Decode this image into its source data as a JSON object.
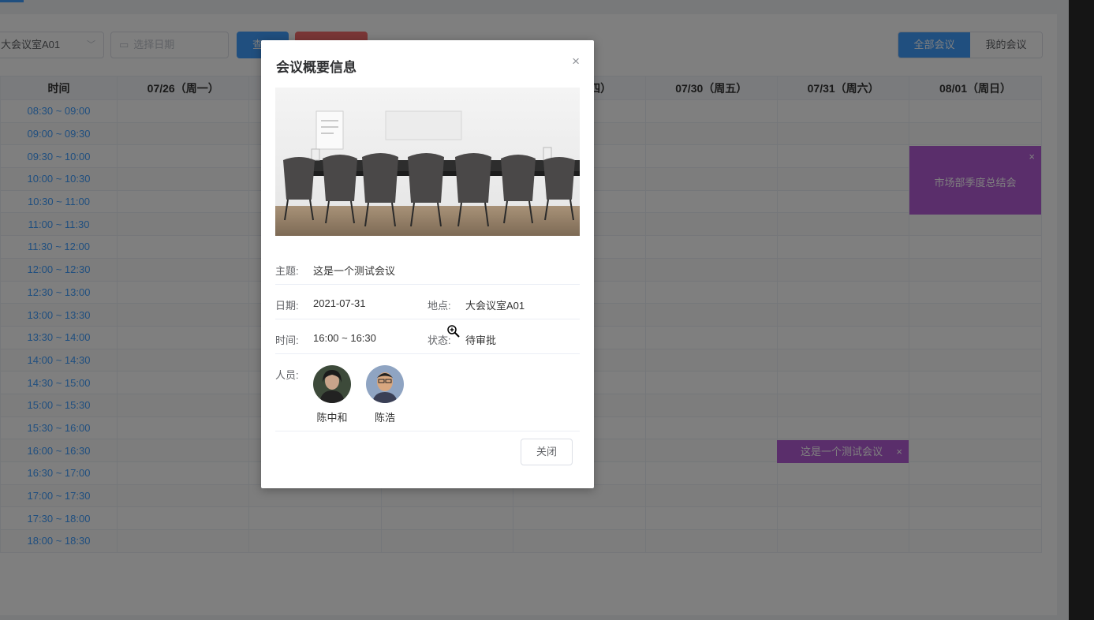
{
  "toolbar": {
    "room_value": "大会议室A01",
    "date_placeholder": "选择日期",
    "query_label": "查",
    "view_all": "全部会议",
    "view_mine": "我的会议"
  },
  "schedule": {
    "headers": [
      "时间",
      "07/26（周一）",
      "",
      "",
      "四）",
      "07/30（周五）",
      "07/31（周六）",
      "08/01（周日）"
    ],
    "times": [
      "08:30 ~ 09:00",
      "09:00 ~ 09:30",
      "09:30 ~ 10:00",
      "10:00 ~ 10:30",
      "10:30 ~ 11:00",
      "11:00 ~ 11:30",
      "11:30 ~ 12:00",
      "12:00 ~ 12:30",
      "12:30 ~ 13:00",
      "13:00 ~ 13:30",
      "13:30 ~ 14:00",
      "14:00 ~ 14:30",
      "14:30 ~ 15:00",
      "15:00 ~ 15:30",
      "15:30 ~ 16:00",
      "16:00 ~ 16:30",
      "16:30 ~ 17:00",
      "17:00 ~ 17:30",
      "17:30 ~ 18:00",
      "18:00 ~ 18:30"
    ],
    "events": [
      {
        "title": "市场部季度总结会",
        "close": "×"
      },
      {
        "title": "这是一个测试会议",
        "close": "×"
      }
    ]
  },
  "dialog": {
    "title": "会议概要信息",
    "close_icon": "×",
    "topic_label": "主题:",
    "topic": "这是一个测试会议",
    "date_label": "日期:",
    "date": "2021-07-31",
    "location_label": "地点:",
    "location": "大会议室A01",
    "time_label": "时间:",
    "time": "16:00 ~ 16:30",
    "status_label": "状态:",
    "status": "待审批",
    "people_label": "人员:",
    "people": [
      "陈中和",
      "陈浩"
    ],
    "close_button": "关闭"
  },
  "colors": {
    "primary": "#409eff",
    "event": "#b45cd6",
    "danger": "#f56c6c"
  }
}
